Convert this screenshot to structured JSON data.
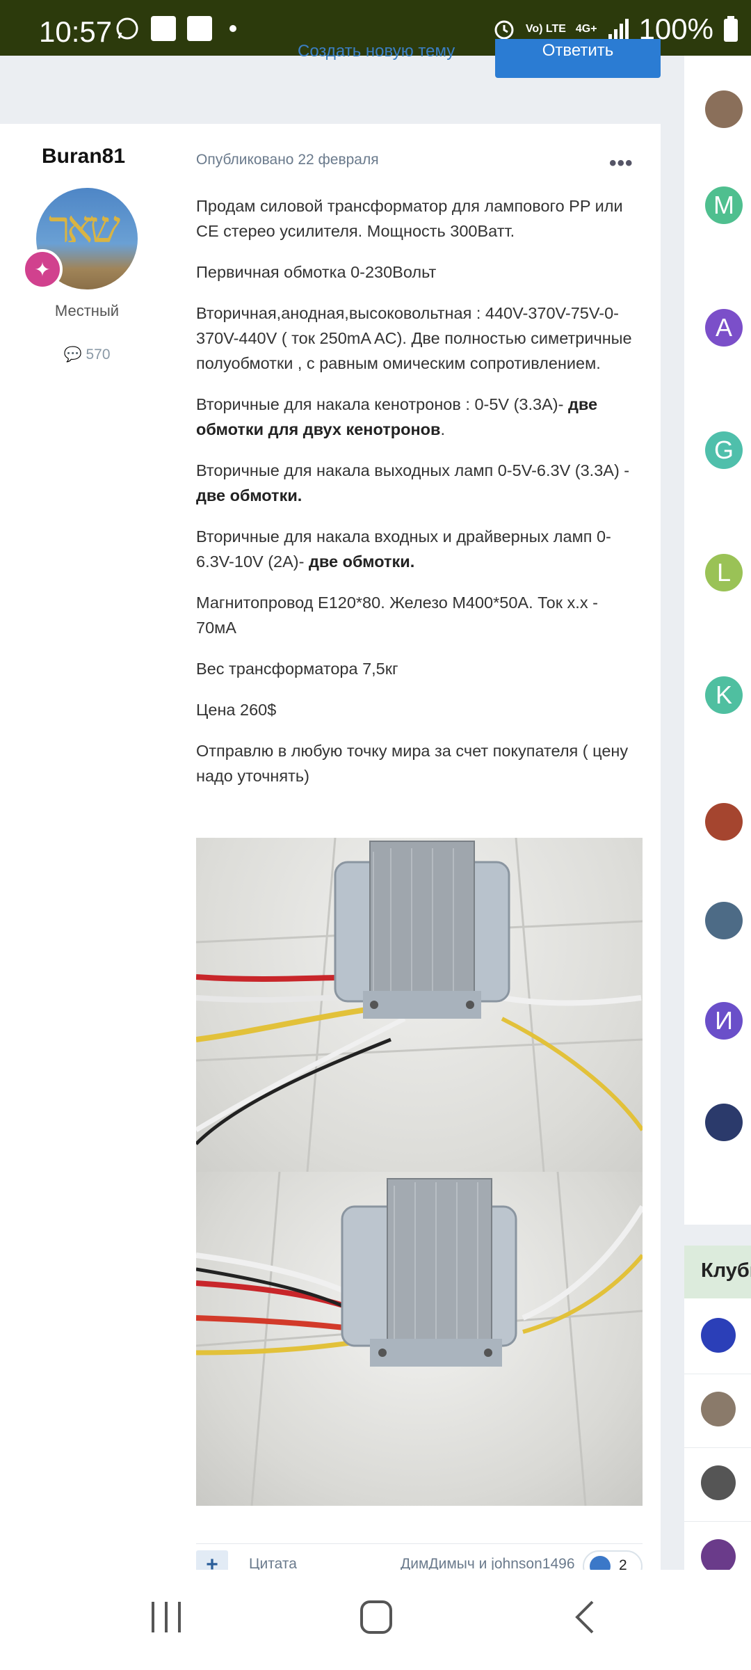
{
  "status_bar": {
    "time": "10:57",
    "network": "4G+",
    "lte": "Vo) LTE",
    "battery": "100%",
    "icons": [
      "whatsapp-icon",
      "notification-icon",
      "notification-icon",
      "dot-icon",
      "alarm-icon",
      "signal-icon",
      "battery-icon"
    ]
  },
  "topbar": {
    "new_topic_link": "Создать новую тему",
    "reply_button": "Ответить"
  },
  "post": {
    "author": "Buran81",
    "rank": "Местный",
    "post_count": "570",
    "date": "Опубликовано 22 февраля",
    "more_label": "•••",
    "paragraphs": [
      {
        "text": "Продам силовой трансформатор для лампового PP или СЕ стерео усилителя. Мощность 300Ватт.",
        "bold": "",
        "tail": ""
      },
      {
        "text": "Первичная обмотка  0-230Вольт",
        "bold": "",
        "tail": ""
      },
      {
        "text": "Вторичная,анодная,высоковольтная :  440V-370V-75V-0-370V-440V   ( ток 250mA AC).  Две полностью симетричные полуобмотки , с равным омическим сопротивлением.",
        "bold": "",
        "tail": ""
      },
      {
        "text": "Вторичные для накала кенотронов : 0-5V (3.3A)-  ",
        "bold": "две обмотки для двух кенотронов",
        "tail": "."
      },
      {
        "text": "Вторичные для накала выходных ламп 0-5V-6.3V (3.3A) - ",
        "bold": "две обмотки.",
        "tail": ""
      },
      {
        "text": "Вторичные для накала входных и драйверных ламп 0-6.3V-10V (2A)- ",
        "bold": "две обмотки.",
        "tail": ""
      },
      {
        "text": "Магнитопровод Е120*80. Железо М400*50А. Ток х.х - 70мА",
        "bold": "",
        "tail": ""
      },
      {
        "text": "Вес трансформатора 7,5кг",
        "bold": "",
        "tail": ""
      },
      {
        "text": "Цена 260$",
        "bold": "",
        "tail": ""
      },
      {
        "text": "Отправлю в любую точку мира  за счет покупателя ( цену надо уточнять)",
        "bold": "",
        "tail": ""
      }
    ],
    "actions": {
      "plus": "+",
      "quote": "Цитата",
      "reacted_by": "ДимДимыч и johnson1496",
      "reaction_count": "2"
    }
  },
  "sidebar": {
    "avatars": [
      {
        "letter": "",
        "color": "#8a6f5a"
      },
      {
        "letter": "M",
        "color": "#4fbf8f"
      },
      {
        "letter": "A",
        "color": "#7b4fc9"
      },
      {
        "letter": "G",
        "color": "#4fbfab"
      },
      {
        "letter": "L",
        "color": "#9ac256"
      },
      {
        "letter": "K",
        "color": "#4fbfa0"
      },
      {
        "letter": "",
        "color": "#a5452f"
      },
      {
        "letter": "",
        "color": "#4d6b86"
      },
      {
        "letter": "И",
        "color": "#6a4fc9"
      },
      {
        "letter": "",
        "color": "#2b3a6b"
      }
    ],
    "clubs_title": "Клубы",
    "club_colors": [
      "#2b3fb8",
      "#8a7a6a",
      "#555555",
      "#6a3b8a"
    ]
  },
  "navbar": {
    "icons": [
      "recent-apps-icon",
      "home-icon",
      "back-icon"
    ]
  },
  "colors": {
    "status_bar": "#2c3a0c",
    "accent": "#2b7cd3",
    "badge": "#d1418e"
  }
}
